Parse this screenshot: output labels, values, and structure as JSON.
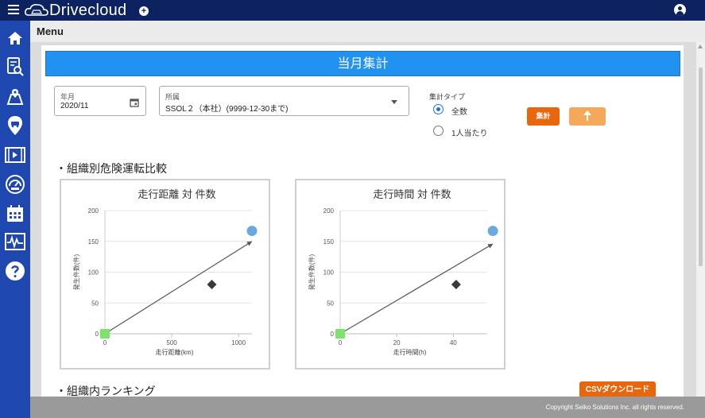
{
  "app": {
    "brand": "Drivecloud",
    "brand_plus": "+"
  },
  "menubar": {
    "title": "Menu"
  },
  "sidebar": {
    "items": [
      {
        "name": "home-icon"
      },
      {
        "name": "report-search-icon"
      },
      {
        "name": "map-route-icon"
      },
      {
        "name": "car-pin-icon"
      },
      {
        "name": "video-icon"
      },
      {
        "name": "gauge-icon"
      },
      {
        "name": "calendar-icon"
      },
      {
        "name": "waveform-icon"
      },
      {
        "name": "help-icon"
      }
    ]
  },
  "header": {
    "title": "当月集計"
  },
  "filters": {
    "month": {
      "label": "年月",
      "value": "2020/11"
    },
    "org": {
      "label": "所属",
      "value": "SSOL２（本社）(9999-12-30まで)"
    },
    "agg_type": {
      "label": "集計タイプ",
      "options": [
        "全数",
        "1人当たり"
      ],
      "selected": "全数"
    },
    "run_label": "集計"
  },
  "sections": {
    "danger": "・組織別危険運転比較",
    "ranking": "・組織内ランキング"
  },
  "csv_label": "CSVダウンロード",
  "footer": {
    "copyright": "Copyright Seiko Solutions Inc. all rights reserved."
  },
  "colors": {
    "accent": "#2192ef",
    "brand_bg": "#0d2260",
    "sidebar": "#1e47b0",
    "action": "#e8660c"
  },
  "chart_data": [
    {
      "type": "scatter",
      "title": "走行距離 対 件数",
      "xlabel": "走行距離(km)",
      "ylabel": "発生件数(件)",
      "xticks": [
        0,
        500,
        1000
      ],
      "yticks": [
        0,
        50,
        100,
        150,
        200
      ],
      "xlim": [
        0,
        1100
      ],
      "ylim": [
        0,
        200
      ],
      "points": [
        {
          "x": 0,
          "y": 0,
          "marker": "square",
          "color": "#7ee36b"
        },
        {
          "x": 800,
          "y": 80,
          "marker": "diamond",
          "color": "#3a3a3a"
        },
        {
          "x": 1100,
          "y": 167,
          "marker": "circle",
          "color": "#6aa8e0"
        }
      ],
      "trend_line": {
        "from": [
          0,
          0
        ],
        "to": [
          1100,
          150
        ]
      }
    },
    {
      "type": "scatter",
      "title": "走行時間 対 件数",
      "xlabel": "走行時間(h)",
      "ylabel": "発生件数(件)",
      "xticks": [
        0,
        20,
        40
      ],
      "yticks": [
        0,
        50,
        100,
        150,
        200
      ],
      "xlim": [
        0,
        52
      ],
      "ylim": [
        0,
        200
      ],
      "points": [
        {
          "x": 0,
          "y": 0,
          "marker": "square",
          "color": "#7ee36b"
        },
        {
          "x": 41,
          "y": 80,
          "marker": "diamond",
          "color": "#3a3a3a"
        },
        {
          "x": 54,
          "y": 167,
          "marker": "circle",
          "color": "#6aa8e0"
        }
      ],
      "trend_line": {
        "from": [
          0,
          0
        ],
        "to": [
          54,
          146
        ]
      }
    }
  ]
}
